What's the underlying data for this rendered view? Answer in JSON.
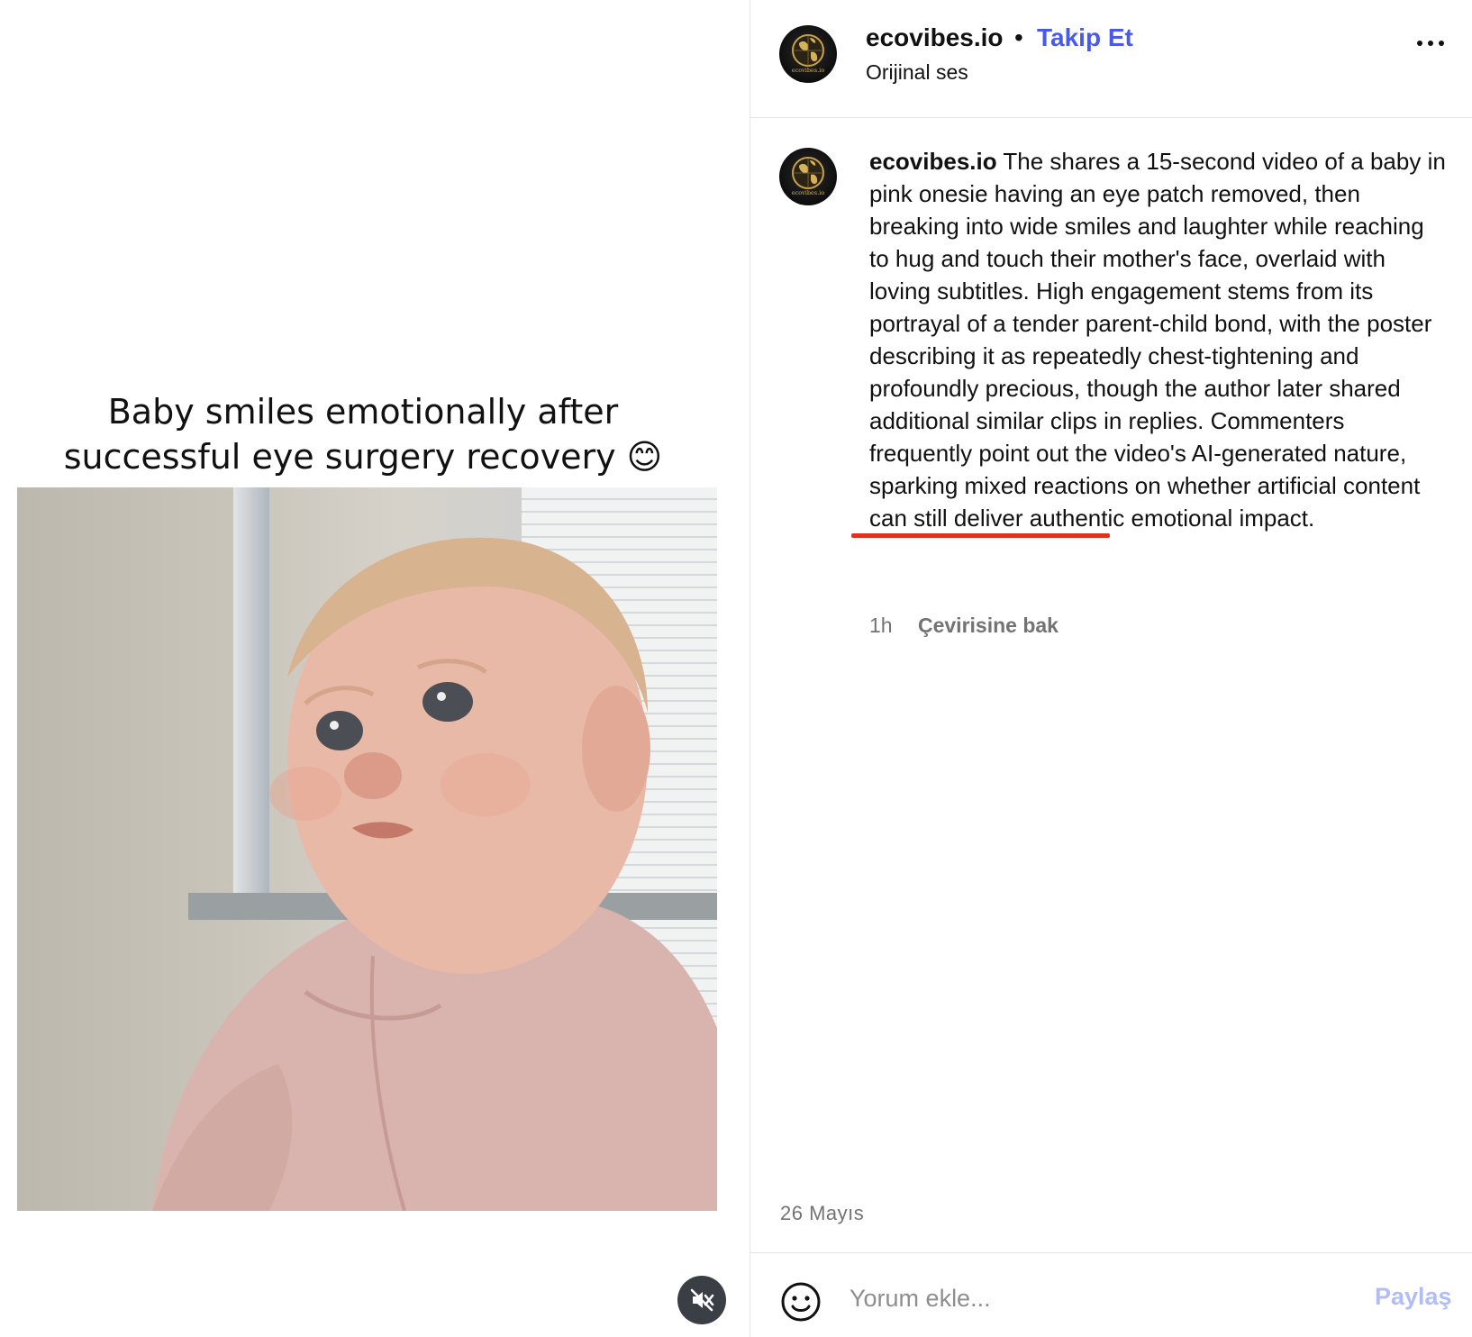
{
  "video": {
    "caption": "Baby smiles emotionally after successful eye surgery recovery 😊",
    "mute_icon": "speaker-muted-icon"
  },
  "header": {
    "username": "ecovibes.io",
    "separator": "•",
    "follow_label": "Takip Et",
    "audio_label": "Orijinal ses",
    "avatar_text": "ecovibes.io",
    "more_icon": "more-options-icon"
  },
  "post": {
    "username": "ecovibes.io",
    "text_part1": "The shares a 15-second video of a baby in pink onesie having an eye patch removed, then breaking into wide smiles and laughter while reaching to hug and touch their mother's face, overlaid with loving subtitles. High engagement stems from its portrayal of a tender parent-child bond, with the poster describing it as repeatedly chest-tightening and profoundly precious, though the author later shared additional similar clips in replies. Commenters frequently point out the video's ",
    "highlight": "AI-generated nature",
    "text_part2": ", sparking mixed reactions on whether artificial content can still deliver authentic emotional impact.",
    "time": "1h",
    "translate_label": "Çevirisine bak",
    "highlight_color": "#e0321f"
  },
  "date": "26 Mayıs",
  "footer": {
    "comment_placeholder": "Yorum ekle...",
    "share_label": "Paylaş",
    "emoji_icon": "emoji-smile-icon"
  },
  "colors": {
    "follow": "#4a5ae8",
    "share_disabled": "#b3bdf5",
    "muted_text": "#737373"
  }
}
